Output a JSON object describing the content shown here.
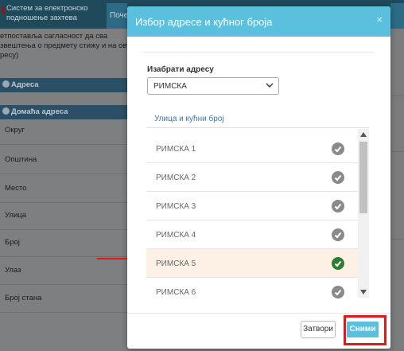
{
  "background": {
    "app_title_line1": "Систем за електронско",
    "app_title_line2": "подношење захтева",
    "tab_label": "Поче",
    "intro_line1": "етпостављa сагласност да сва",
    "intro_line2": "звештења о предмету стижу и на ову",
    "intro_line3": "ресу)",
    "section_address": "Адреса",
    "section_home_address": "Домаћа адреса",
    "fields": [
      "Округ",
      "Општина",
      "Место",
      "Улица",
      "Број",
      "Улаз",
      "Број стана"
    ]
  },
  "modal": {
    "title": "Избор адресе и кућног броја",
    "close_glyph": "×",
    "select_label": "Изабрати адресу",
    "select_value": "РИМСКА",
    "column_header": "Улица и кућни број",
    "rows": [
      {
        "label": "РИМСКА 1",
        "selected": false
      },
      {
        "label": "РИМСКА 2",
        "selected": false
      },
      {
        "label": "РИМСКА 3",
        "selected": false
      },
      {
        "label": "РИМСКА 4",
        "selected": false
      },
      {
        "label": "РИМСКА 5",
        "selected": true
      },
      {
        "label": "РИМСКА 6",
        "selected": false
      }
    ],
    "buttons": {
      "close_label": "Затвори",
      "save_label": "Сними"
    }
  },
  "colors": {
    "accent": "#5bc0de",
    "check_default": "#8a8a8a",
    "check_selected": "#2e7d32",
    "highlight_row": "#fcf1e4",
    "annotation_red": "#e0191b"
  },
  "icons": {
    "close": "close-icon",
    "chevron": "chevron-down-icon",
    "check": "check-circle-icon",
    "arrow": "arrow-right-icon"
  }
}
